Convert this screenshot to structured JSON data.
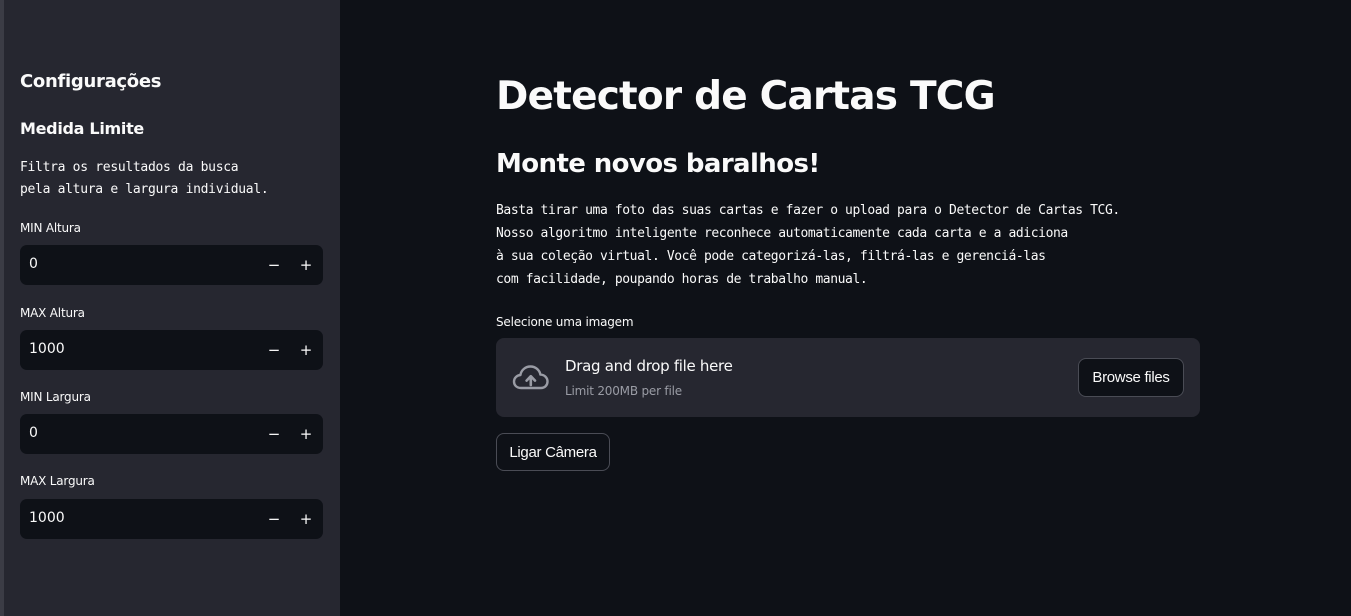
{
  "sidebar": {
    "heading": "Configurações",
    "subheading": "Medida Limite",
    "description": "Filtra os resultados da busca\npela altura e largura individual.",
    "fields": [
      {
        "label": "MIN Altura",
        "value": "0",
        "minus": "−",
        "plus": "+"
      },
      {
        "label": "MAX Altura",
        "value": "1000",
        "minus": "−",
        "plus": "+"
      },
      {
        "label": "MIN Largura",
        "value": "0",
        "minus": "−",
        "plus": "+"
      },
      {
        "label": "MAX Largura",
        "value": "1000",
        "minus": "−",
        "plus": "+"
      }
    ]
  },
  "main": {
    "title": "Detector de Cartas TCG",
    "subtitle": "Monte novos baralhos!",
    "paragraph": "Basta tirar uma foto das suas cartas e fazer o upload para o Detector de Cartas TCG.\nNosso algoritmo inteligente reconhece automaticamente cada carta e a adiciona\nà sua coleção virtual. Você pode categorizá-las, filtrá-las e gerenciá-las\ncom facilidade, poupando horas de trabalho manual.",
    "uploader": {
      "label": "Selecione uma imagem",
      "drag_text": "Drag and drop file here",
      "limit_text": "Limit 200MB per file",
      "browse_label": "Browse files",
      "icon": "cloud-upload-icon"
    },
    "camera_button": "Ligar Câmera"
  },
  "colors": {
    "background": "#0e1117",
    "sidebar": "#262730",
    "dropzone": "#262730",
    "text": "#fafafa",
    "muted": "#9a9ca5"
  }
}
